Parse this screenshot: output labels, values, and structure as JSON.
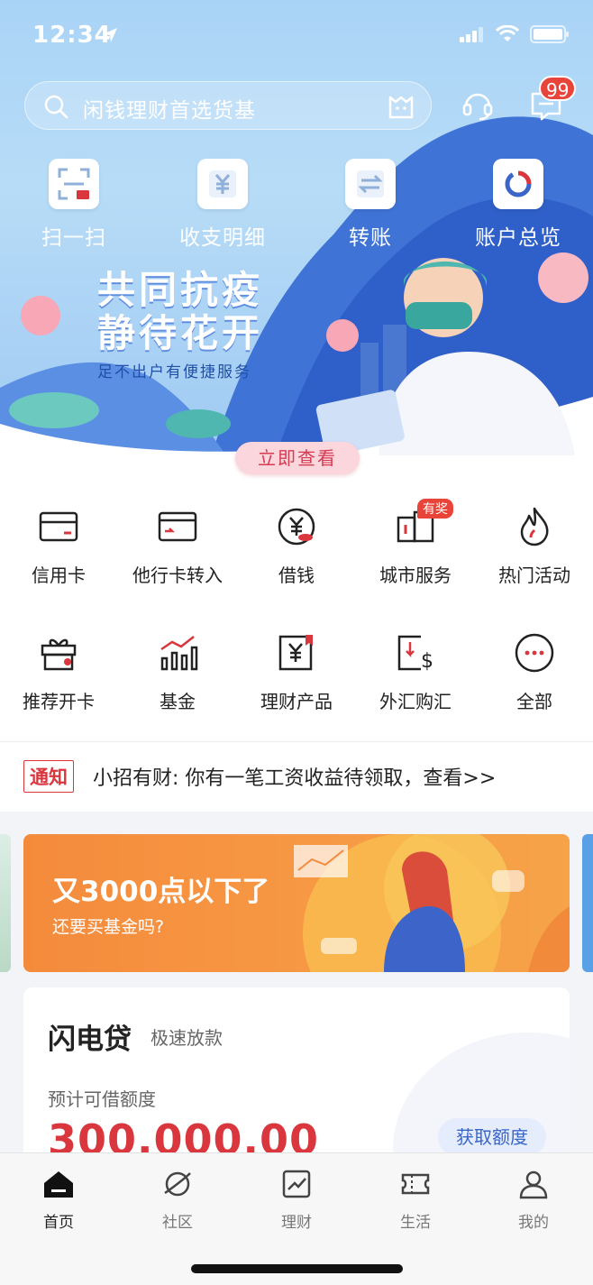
{
  "status": {
    "time": "12:34"
  },
  "search": {
    "placeholder": "闲钱理财首选货基"
  },
  "header": {
    "message_badge": "99"
  },
  "quick_actions": [
    {
      "label": "扫一扫",
      "icon": "scan-icon"
    },
    {
      "label": "收支明细",
      "icon": "yen-statement-icon"
    },
    {
      "label": "转账",
      "icon": "transfer-icon"
    },
    {
      "label": "账户总览",
      "icon": "account-overview-icon"
    }
  ],
  "banner": {
    "title_line1": "共同抗疫",
    "title_line2": "静待花开",
    "subtitle": "足不出户有便捷服务",
    "button": "立即查看"
  },
  "functions_row1": [
    {
      "label": "信用卡",
      "icon": "credit-card-icon"
    },
    {
      "label": "他行卡转入",
      "icon": "card-transfer-in-icon"
    },
    {
      "label": "借钱",
      "icon": "borrow-icon"
    },
    {
      "label": "城市服务",
      "icon": "city-service-icon",
      "tag": "有奖"
    },
    {
      "label": "热门活动",
      "icon": "flame-icon"
    }
  ],
  "functions_row2": [
    {
      "label": "推荐开卡",
      "icon": "gift-icon"
    },
    {
      "label": "基金",
      "icon": "fund-chart-icon"
    },
    {
      "label": "理财产品",
      "icon": "wealth-product-icon"
    },
    {
      "label": "外汇购汇",
      "icon": "forex-icon"
    },
    {
      "label": "全部",
      "icon": "more-icon"
    }
  ],
  "notice": {
    "tag": "通知",
    "text": "小招有财: 你有一笔工资收益待领取，查看>>"
  },
  "promo": {
    "title": "又3000点以下了",
    "subtitle": "还要买基金吗?"
  },
  "loan": {
    "title": "闪电贷",
    "tagline": "极速放款",
    "label": "预计可借额度",
    "amount": "300,000.00",
    "button": "获取额度"
  },
  "tabs": [
    {
      "label": "首页",
      "icon": "home-icon",
      "active": true
    },
    {
      "label": "社区",
      "icon": "planet-icon",
      "active": false
    },
    {
      "label": "理财",
      "icon": "trend-chart-icon",
      "active": false
    },
    {
      "label": "生活",
      "icon": "ticket-icon",
      "active": false
    },
    {
      "label": "我的",
      "icon": "user-icon",
      "active": false
    }
  ],
  "colors": {
    "brand_red": "#d9363e",
    "hero_blue": "#a9d3f6",
    "promo_orange": "#f48b3c",
    "accent_blue": "#3a66c9"
  }
}
